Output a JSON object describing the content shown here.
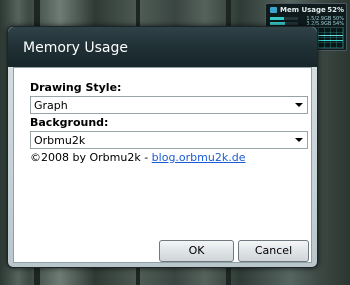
{
  "gadget": {
    "title": "Mem Usage",
    "percent": "52%",
    "rows": [
      {
        "value": "1.5/2.9GB 50%",
        "fill": 0.5
      },
      {
        "value": "3.2/5.9GB 54%",
        "fill": 0.54
      }
    ],
    "accent": "#39c7c7"
  },
  "dialog": {
    "title": "Memory Usage",
    "drawing_style": {
      "label": "Drawing Style:",
      "value": "Graph"
    },
    "background": {
      "label": "Background:",
      "value": "Orbmu2k"
    },
    "copyright": {
      "text": "©2008 by Orbmu2k - ",
      "link": "blog.orbmu2k.de"
    },
    "buttons": {
      "ok": "OK",
      "cancel": "Cancel"
    }
  }
}
